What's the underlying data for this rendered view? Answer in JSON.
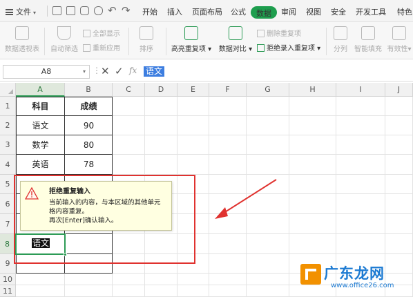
{
  "menubar": {
    "file": "文件",
    "tabs": [
      {
        "label": "开始",
        "active": false
      },
      {
        "label": "插入",
        "active": false
      },
      {
        "label": "页面布局",
        "active": false
      },
      {
        "label": "公式",
        "active": false
      },
      {
        "label": "数据",
        "active": true
      },
      {
        "label": "审阅",
        "active": false
      },
      {
        "label": "视图",
        "active": false
      },
      {
        "label": "安全",
        "active": false
      },
      {
        "label": "开发工具",
        "active": false
      },
      {
        "label": "特色",
        "active": false
      }
    ],
    "accent_color": "#1e9e4e"
  },
  "ribbon": {
    "pivot": "数据透视表",
    "autofilter": "自动筛选",
    "show_all": "全部显示",
    "reapply": "重新应用",
    "sort": "排序",
    "highlight_dup": "高亮重复项",
    "compare": "数据对比",
    "delete_dup": "删除重复项",
    "reject_dup": "拒绝录入重复项",
    "split": "分列",
    "smart_fill": "智能填充",
    "validity": "有效性"
  },
  "formula_bar": {
    "name_box": "A8",
    "fx": "fx",
    "formula": "语文"
  },
  "sheet": {
    "columns": [
      "A",
      "B",
      "C",
      "D",
      "E",
      "F",
      "G",
      "H",
      "I",
      "J"
    ],
    "rows": [
      "1",
      "2",
      "3",
      "4",
      "5",
      "6",
      "7",
      "8",
      "9",
      "10",
      "11"
    ],
    "selected_column": "A",
    "selected_row": "8",
    "table": [
      [
        "科目",
        "成绩"
      ],
      [
        "语文",
        "90"
      ],
      [
        "数学",
        "80"
      ],
      [
        "英语",
        "78"
      ]
    ],
    "active_value": "语文"
  },
  "popup": {
    "title": "拒绝重复输入",
    "line1": "当前输入的内容，与本区域的其他单元",
    "line2": "格内容重复。",
    "line3": "再次[Enter]确认输入。"
  },
  "annotation_color": "#e0322f",
  "watermark": {
    "name": "广东龙网",
    "url": "www.office26.com"
  }
}
